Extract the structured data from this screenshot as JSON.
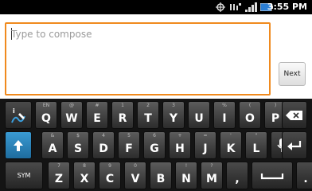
{
  "status_bar": {
    "time": "3:55 PM",
    "icons": [
      "gps-icon",
      "network-4g-icon",
      "signal-bars-icon",
      "battery-icon"
    ]
  },
  "compose": {
    "placeholder": "Type to compose",
    "next_label": "Next",
    "border_color": "#f08a1e"
  },
  "keyboard": {
    "row1": [
      {
        "main": "",
        "sec": "",
        "name": "input-options-key",
        "icon": "handwriting-pen-icon"
      },
      {
        "main": "Q",
        "sec": "EN"
      },
      {
        "main": "W",
        "sec": "@"
      },
      {
        "main": "E",
        "sec": "#"
      },
      {
        "main": "R",
        "sec": "1"
      },
      {
        "main": "T",
        "sec": "2"
      },
      {
        "main": "Y",
        "sec": "3"
      },
      {
        "main": "U",
        "sec": ""
      },
      {
        "main": "I",
        "sec": "%"
      },
      {
        "main": "O",
        "sec": "("
      },
      {
        "main": "P",
        "sec": ")"
      },
      {
        "main": "",
        "sec": "",
        "name": "delete-key",
        "icon": "backspace-icon"
      }
    ],
    "row2": [
      {
        "main": "",
        "sec": "",
        "name": "shift-key",
        "icon": "shift-arrow-icon"
      },
      {
        "main": "A",
        "sec": "&"
      },
      {
        "main": "S",
        "sec": "$"
      },
      {
        "main": "D",
        "sec": "4"
      },
      {
        "main": "F",
        "sec": "5"
      },
      {
        "main": "G",
        "sec": "6"
      },
      {
        "main": "H",
        "sec": "+"
      },
      {
        "main": "J",
        "sec": "="
      },
      {
        "main": "K",
        "sec": "'"
      },
      {
        "main": "L",
        "sec": "\""
      },
      {
        "main": "",
        "sec": "",
        "name": "voice-input-key",
        "icon": "microphone-icon"
      },
      {
        "main": "",
        "sec": "",
        "name": "enter-key",
        "icon": "enter-arrow-icon"
      }
    ],
    "row3": [
      {
        "main": "SYM",
        "sec": "",
        "name": "symbols-key"
      },
      {
        "main": "Z",
        "sec": "7"
      },
      {
        "main": "X",
        "sec": "8"
      },
      {
        "main": "C",
        "sec": "9"
      },
      {
        "main": "V",
        "sec": "0"
      },
      {
        "main": "B",
        "sec": ""
      },
      {
        "main": "N",
        "sec": "!"
      },
      {
        "main": "M",
        "sec": "?"
      },
      {
        "main": ",",
        "sec": "",
        "name": "comma-key"
      },
      {
        "main": "",
        "sec": "",
        "name": "space-key",
        "icon": "space-bar-icon"
      },
      {
        "main": ".",
        "sec": "",
        "name": "period-key"
      }
    ]
  }
}
